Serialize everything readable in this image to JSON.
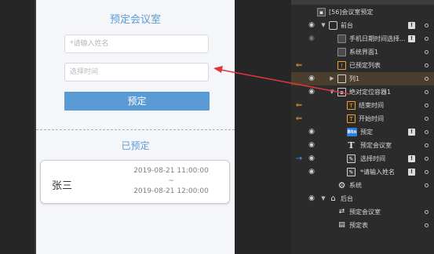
{
  "preview": {
    "form_title": "预定会议室",
    "name_placeholder": "*请输入姓名",
    "time_placeholder": "选择时间",
    "submit_label": "预定",
    "booked_title": "已预定",
    "booking": {
      "name": "张三",
      "start": "2019-08-21 11:00:00",
      "separator": "~",
      "end": "2019-08-21 12:00:00"
    }
  },
  "colors": {
    "accent": "#5b9bd5",
    "highlight_row": "#4a3f2e",
    "marker_orange": "#f0a030",
    "marker_blue": "#3ea0ff",
    "arrow": "#d9373a"
  },
  "layers": [
    {
      "label": "[56]会议室预定",
      "icon": "folder-icon"
    },
    {
      "label": "前台",
      "icon": "phone-icon",
      "badge": "!"
    },
    {
      "label": "手机日期时间选择...",
      "icon": "page-icon",
      "badge": "!"
    },
    {
      "label": "系统界面1",
      "icon": "page-icon"
    },
    {
      "label": "已预定列表",
      "icon": "warning-icon"
    },
    {
      "label": "列1",
      "icon": "list-icon"
    },
    {
      "label": "绝对定位容器1",
      "icon": "container-icon"
    },
    {
      "label": "结束时间",
      "icon": "text-icon"
    },
    {
      "label": "开始时间",
      "icon": "text-icon"
    },
    {
      "label": "预定",
      "icon": "button-icon",
      "icon_text": "Btn",
      "badge": "!"
    },
    {
      "label": "预定会议室",
      "icon": "text-icon",
      "icon_text": "T"
    },
    {
      "label": "选择时间",
      "icon": "edit-icon",
      "badge": "!"
    },
    {
      "label": "*请输入姓名",
      "icon": "edit-icon",
      "badge": "!"
    },
    {
      "label": "系统",
      "icon": "gear-icon"
    },
    {
      "label": "后台",
      "icon": "home-icon"
    },
    {
      "label": "预定会议室",
      "icon": "swap-icon"
    },
    {
      "label": "预定表",
      "icon": "database-icon"
    }
  ]
}
